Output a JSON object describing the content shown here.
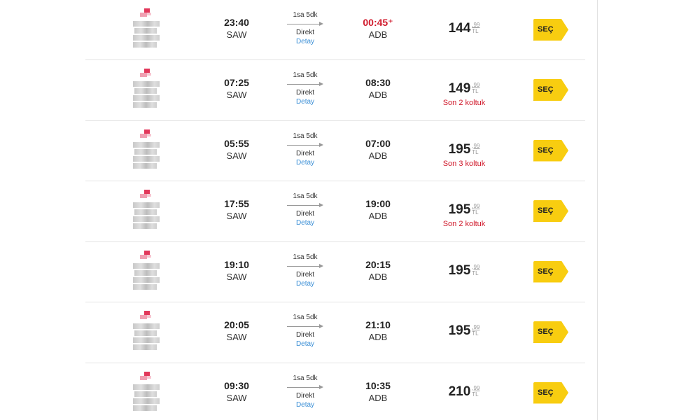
{
  "flights": [
    {
      "dep_time": "23:40",
      "dep_code": "SAW",
      "duration": "1sa 5dk",
      "type": "Direkt",
      "detail": "Detay",
      "arr_time": "00:45⁺",
      "arr_late": true,
      "arr_code": "ADB",
      "price": "144",
      "cents": ",99",
      "currency": "TL",
      "seats": "",
      "button": "SEÇ"
    },
    {
      "dep_time": "07:25",
      "dep_code": "SAW",
      "duration": "1sa 5dk",
      "type": "Direkt",
      "detail": "Detay",
      "arr_time": "08:30",
      "arr_late": false,
      "arr_code": "ADB",
      "price": "149",
      "cents": ",99",
      "currency": "TL",
      "seats": "Son 2 koltuk",
      "button": "SEÇ"
    },
    {
      "dep_time": "05:55",
      "dep_code": "SAW",
      "duration": "1sa 5dk",
      "type": "Direkt",
      "detail": "Detay",
      "arr_time": "07:00",
      "arr_late": false,
      "arr_code": "ADB",
      "price": "195",
      "cents": ",99",
      "currency": "TL",
      "seats": "Son 3 koltuk",
      "button": "SEÇ"
    },
    {
      "dep_time": "17:55",
      "dep_code": "SAW",
      "duration": "1sa 5dk",
      "type": "Direkt",
      "detail": "Detay",
      "arr_time": "19:00",
      "arr_late": false,
      "arr_code": "ADB",
      "price": "195",
      "cents": ",99",
      "currency": "TL",
      "seats": "Son 2 koltuk",
      "button": "SEÇ"
    },
    {
      "dep_time": "19:10",
      "dep_code": "SAW",
      "duration": "1sa 5dk",
      "type": "Direkt",
      "detail": "Detay",
      "arr_time": "20:15",
      "arr_late": false,
      "arr_code": "ADB",
      "price": "195",
      "cents": ",99",
      "currency": "TL",
      "seats": "",
      "button": "SEÇ"
    },
    {
      "dep_time": "20:05",
      "dep_code": "SAW",
      "duration": "1sa 5dk",
      "type": "Direkt",
      "detail": "Detay",
      "arr_time": "21:10",
      "arr_late": false,
      "arr_code": "ADB",
      "price": "195",
      "cents": ",99",
      "currency": "TL",
      "seats": "",
      "button": "SEÇ"
    },
    {
      "dep_time": "09:30",
      "dep_code": "SAW",
      "duration": "1sa 5dk",
      "type": "Direkt",
      "detail": "Detay",
      "arr_time": "10:35",
      "arr_late": false,
      "arr_code": "ADB",
      "price": "210",
      "cents": ",99",
      "currency": "TL",
      "seats": "",
      "button": "SEÇ"
    }
  ],
  "colors": {
    "select_button": "#f8cd10",
    "late_time": "#d0192b",
    "seats_warning": "#d0192b",
    "detail_link": "#3b8fd6",
    "airline_logo": "#e2375a"
  },
  "icons": {
    "airline_logo": "airline-logo-icon",
    "flight_arrow": "arrow-right-icon"
  }
}
